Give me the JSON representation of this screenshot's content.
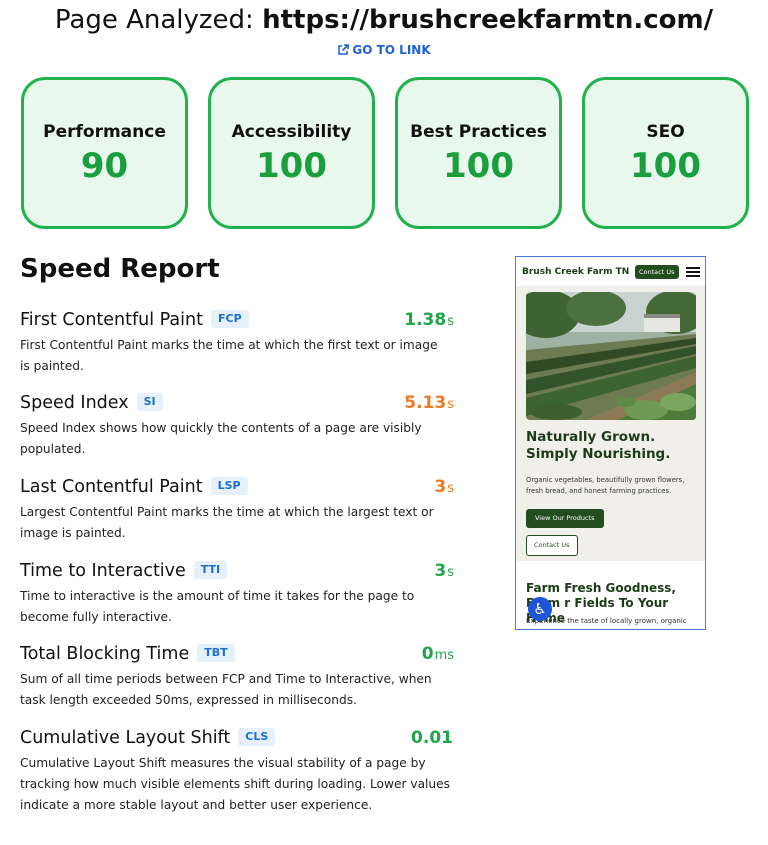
{
  "header": {
    "label": "Page Analyzed:",
    "url": "https://brushcreekfarmtn.com/",
    "go_link_label": "GO TO LINK",
    "go_link_icon": "external-link-icon"
  },
  "scores": [
    {
      "name": "Performance",
      "value": "90"
    },
    {
      "name": "Accessibility",
      "value": "100"
    },
    {
      "name": "Best Practices",
      "value": "100"
    },
    {
      "name": "SEO",
      "value": "100"
    }
  ],
  "colors": {
    "score_green": "#1a9e3e",
    "card_border": "#22b14c",
    "card_bg": "#e8f8ec",
    "metric_green": "#1fa64b",
    "metric_orange": "#f07a22",
    "abbr_blue": "#1c6fd1",
    "link_blue": "#1d63d8"
  },
  "speed_report": {
    "title": "Speed Report",
    "metrics": [
      {
        "name": "First Contentful Paint",
        "abbr": "FCP",
        "value": "1.38",
        "unit": "s",
        "status": "green",
        "desc": "First Contentful Paint marks the time at which the first text or image is painted."
      },
      {
        "name": "Speed Index",
        "abbr": "SI",
        "value": "5.13",
        "unit": "s",
        "status": "orange",
        "desc": "Speed Index shows how quickly the contents of a page are visibly populated."
      },
      {
        "name": "Last Contentful Paint",
        "abbr": "LSP",
        "value": "3",
        "unit": "s",
        "status": "orange",
        "desc": "Largest Contentful Paint marks the time at which the largest text or image is painted."
      },
      {
        "name": "Time to Interactive",
        "abbr": "TTI",
        "value": "3",
        "unit": "s",
        "status": "green",
        "desc": "Time to interactive is the amount of time it takes for the page to become fully interactive."
      },
      {
        "name": "Total Blocking Time",
        "abbr": "TBT",
        "value": "0",
        "unit": "ms",
        "status": "green",
        "desc": "Sum of all time periods between FCP and Time to Interactive, when task length exceeded 50ms, expressed in milliseconds."
      },
      {
        "name": "Cumulative Layout Shift",
        "abbr": "CLS",
        "value": "0.01",
        "unit": "",
        "status": "green",
        "desc": "Cumulative Layout Shift measures the visual stability of a page by tracking how much visible elements shift during loading. Lower values indicate a more stable layout and better user experience."
      }
    ]
  },
  "preview": {
    "brand": "Brush Creek Farm TN",
    "nav_contact": "Contact Us",
    "menu_icon": "hamburger-menu-icon",
    "hero_title": "Naturally Grown. Simply Nourishing.",
    "hero_text": "Organic vegetables, beautifully grown flowers, fresh bread, and honest farming practices.",
    "primary_button": "View Our Products",
    "secondary_button": "Contact Us",
    "section_title": "Farm Fresh Goodness, From Our Fields To Your Home",
    "section_title_visible": "Farm Fresh Goodness, From r Fields To Your Home",
    "section_text": "Experience the taste of locally grown, organic",
    "accessibility_icon": "accessibility-icon"
  }
}
